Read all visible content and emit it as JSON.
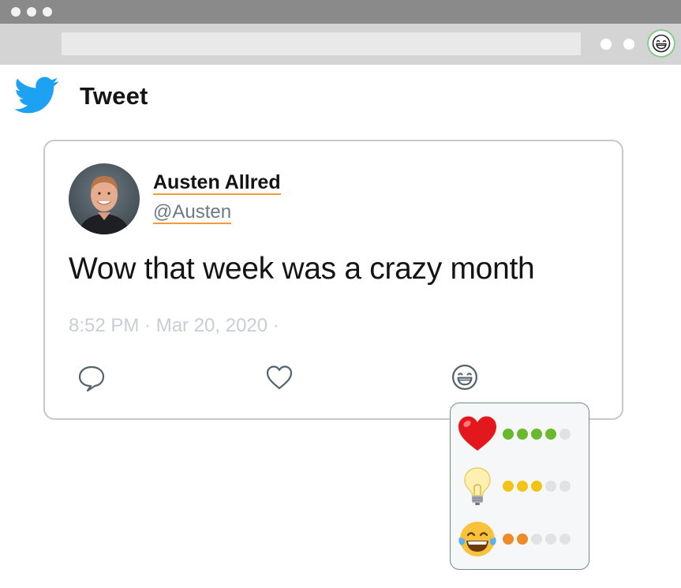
{
  "browser": {
    "titlebar_color": "#8a8a8a",
    "toolbar_color": "#d4d4d4",
    "extension_icon": "laughing-face-icon"
  },
  "page": {
    "heading": "Tweet",
    "logo_icon": "twitter-bird-icon",
    "brand_color": "#1da1f2"
  },
  "tweet": {
    "author_name": "Austen Allred",
    "author_handle": "@Austen",
    "text": "Wow that week was a crazy month",
    "meta": "8:52 PM · Mar 20, 2020 ·",
    "underline_color": "#f39a3a",
    "actions": [
      {
        "name": "reply",
        "icon": "speech-bubble-icon"
      },
      {
        "name": "like",
        "icon": "heart-icon"
      },
      {
        "name": "react",
        "icon": "laughing-face-icon"
      }
    ]
  },
  "reactions": [
    {
      "emoji": "heart",
      "icon": "red-heart-icon",
      "level": 4,
      "max": 5,
      "color": "#6ab82e"
    },
    {
      "emoji": "lightbulb",
      "icon": "lightbulb-icon",
      "level": 3,
      "max": 5,
      "color": "#f2c418"
    },
    {
      "emoji": "tears-of-joy",
      "icon": "tears-of-joy-icon",
      "level": 2,
      "max": 5,
      "color": "#ef8a2a"
    }
  ]
}
